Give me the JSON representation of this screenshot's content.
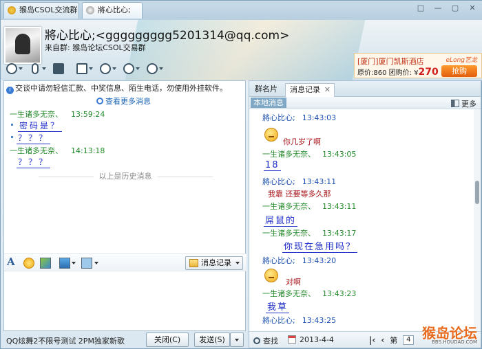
{
  "tabs": [
    {
      "label": "猴岛CSOL交流群"
    },
    {
      "label": "將心比心;"
    }
  ],
  "window_controls": {
    "restore": "□",
    "minimize": "—",
    "maximize": "▢",
    "close": "✕"
  },
  "header": {
    "contact_name": "將心比心;<ggggggggg5201314@qq.com>",
    "from_group": "来自群:   猴岛论坛CSOL交易群",
    "tools": [
      "video-icon",
      "mic-icon",
      "share-screen-icon",
      "file-icon",
      "remote-icon",
      "app-icon",
      "more-icon"
    ]
  },
  "ad": {
    "line1": "[厦门]厦门凯斯酒店",
    "price_label": "原价:860 团购价: ¥",
    "price": "270",
    "brand": "eLong艺龙",
    "button": "抢购"
  },
  "left": {
    "notice": "交谈中请勿轻信汇款、中奖信息、陌生电话，勿使用外挂软件。",
    "view_more": "查看更多消息",
    "messages": [
      {
        "sender": "一生诸多无奈、",
        "time": "13:59:24",
        "lines": [
          "密码是？",
          "？？？"
        ]
      },
      {
        "sender": "一生诸多无奈、",
        "time": "14:13:18",
        "lines": [
          "？？？"
        ]
      }
    ],
    "history_divider": "以上是历史消息",
    "history_button": "消息记录"
  },
  "bottom": {
    "song": "QQ炫舞2不限号测试 2PM独家新歌",
    "close_btn": "关闭(C)",
    "send_btn": "发送(S)"
  },
  "right": {
    "tab_members": "群名片",
    "tab_history": "消息记录",
    "local_msgs": "本地消息",
    "more": "更多",
    "records": [
      {
        "sender": "將心比心;",
        "time": "13:43:03",
        "kind": "blue"
      },
      {
        "text": "你几岁了啊",
        "kind": "emo-red"
      },
      {
        "sender": "一生诸多无奈、",
        "time": "13:43:05",
        "kind": "green"
      },
      {
        "text": "18",
        "kind": "big"
      },
      {
        "sender": "將心比心;",
        "time": "13:43:11",
        "kind": "blue"
      },
      {
        "text": "我靠 还要等多久那",
        "kind": "red"
      },
      {
        "sender": "一生诸多无奈、",
        "time": "13:43:11",
        "kind": "green"
      },
      {
        "text": "屌鼠的",
        "kind": "big"
      },
      {
        "sender": "一生诸多无奈、",
        "time": "13:43:17",
        "kind": "green"
      },
      {
        "text": "你现在急用吗？",
        "kind": "big"
      },
      {
        "sender": "將心比心;",
        "time": "13:43:20",
        "kind": "blue"
      },
      {
        "text": "对啊",
        "kind": "emo-red"
      },
      {
        "sender": "一生诸多无奈、",
        "time": "13:43:23",
        "kind": "green"
      },
      {
        "text": "我草",
        "kind": "big"
      },
      {
        "sender": "將心比心;",
        "time": "13:43:25",
        "kind": "blue"
      }
    ],
    "find": "查找",
    "date": "2013-4-4",
    "page_label": "第",
    "page_value": "4"
  },
  "watermark": {
    "main": "猴岛论坛",
    "sub": "BBS.HOUDAO.COM"
  }
}
